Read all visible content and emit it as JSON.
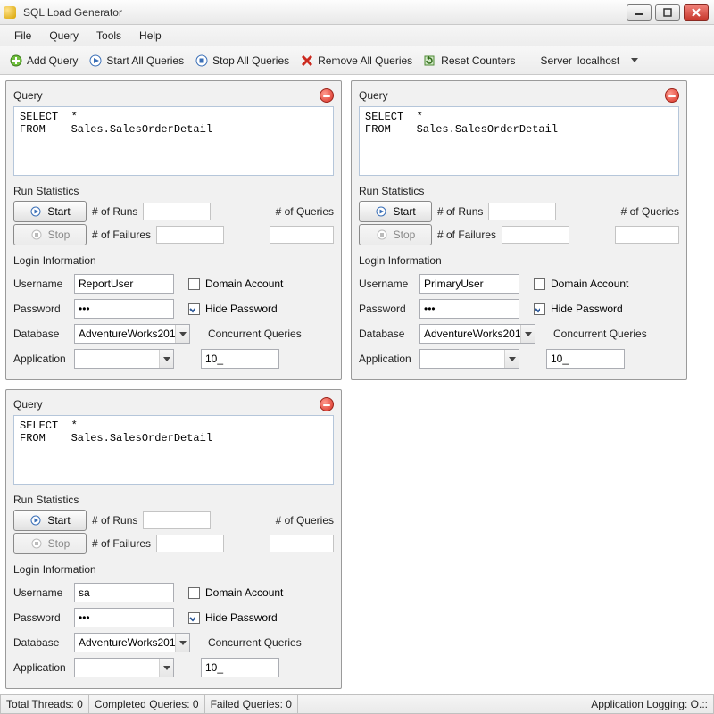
{
  "window": {
    "title": "SQL Load Generator"
  },
  "menu": {
    "file": "File",
    "query": "Query",
    "tools": "Tools",
    "help": "Help"
  },
  "toolbar": {
    "add_query": "Add Query",
    "start_all": "Start All Queries",
    "stop_all": "Stop All Queries",
    "remove_all": "Remove All Queries",
    "reset_counters": "Reset Counters",
    "server_label": "Server",
    "server_value": "localhost"
  },
  "labels": {
    "query": "Query",
    "run_stats": "Run Statistics",
    "start": "Start",
    "stop": "Stop",
    "num_runs": "# of Runs",
    "num_queries": "# of Queries",
    "num_failures": "# of Failures",
    "login_info": "Login Information",
    "username": "Username",
    "password": "Password",
    "database": "Database",
    "application": "Application",
    "domain_account": "Domain Account",
    "hide_password": "Hide Password",
    "concurrent_queries": "Concurrent Queries"
  },
  "panels": [
    {
      "sql": "SELECT  *\nFROM    Sales.SalesOrderDetail",
      "username": "ReportUser",
      "password": "•••",
      "database": "AdventureWorks201",
      "application": "",
      "concurrent": "10_",
      "domain_account": false,
      "hide_password": true
    },
    {
      "sql": "SELECT  *\nFROM    Sales.SalesOrderDetail",
      "username": "PrimaryUser",
      "password": "•••",
      "database": "AdventureWorks201",
      "application": "",
      "concurrent": "10_",
      "domain_account": false,
      "hide_password": true
    },
    {
      "sql": "SELECT  *\nFROM    Sales.SalesOrderDetail",
      "username": "sa",
      "password": "•••",
      "database": "AdventureWorks201",
      "application": "",
      "concurrent": "10_",
      "domain_account": false,
      "hide_password": true
    }
  ],
  "status": {
    "total_threads": "Total Threads:  0",
    "completed_queries": "Completed Queries:  0",
    "failed_queries": "Failed Queries:  0",
    "app_logging": "Application Logging: O.::"
  }
}
